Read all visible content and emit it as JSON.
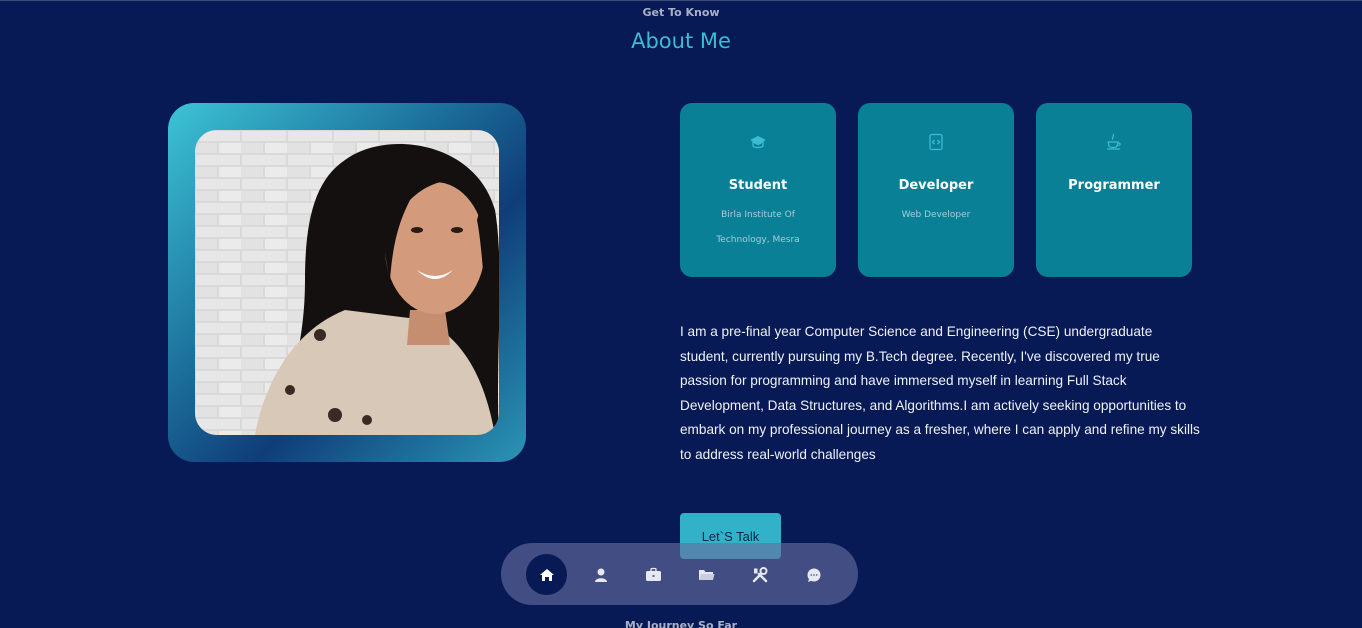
{
  "header": {
    "subtitle": "Get To Know",
    "title": "About Me"
  },
  "profile_photo": {
    "alt": "Portrait photo"
  },
  "cards": [
    {
      "icon": "graduation-cap-icon",
      "title": "Student",
      "description": "Birla Institute Of Technology, Mesra"
    },
    {
      "icon": "code-file-icon",
      "title": "Developer",
      "description": "Web Developer"
    },
    {
      "icon": "java-cup-icon",
      "title": "Programmer",
      "description": ""
    }
  ],
  "about": {
    "text": "I am a pre-final year Computer Science and Engineering (CSE) undergraduate student, currently pursuing my B.Tech degree. Recently, I've discovered my true passion for programming and have immersed myself in learning Full Stack Development, Data Structures, and Algorithms.I am actively seeking opportunities to embark on my professional journey as a fresher, where I can apply and refine my skills to address real-world challenges",
    "button_label": "Let`S Talk"
  },
  "nav": {
    "items": [
      {
        "name": "home-icon",
        "active": true
      },
      {
        "name": "user-icon",
        "active": false
      },
      {
        "name": "briefcase-icon",
        "active": false
      },
      {
        "name": "folder-icon",
        "active": false
      },
      {
        "name": "tools-icon",
        "active": false
      },
      {
        "name": "chat-icon",
        "active": false
      }
    ]
  },
  "next_section": {
    "subtitle": "My Journey So Far"
  },
  "colors": {
    "background": "#081a55",
    "accent": "#3bbcd0",
    "card": "#0a8096"
  }
}
